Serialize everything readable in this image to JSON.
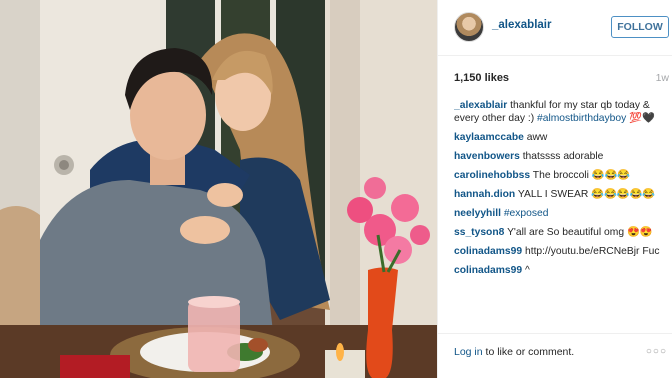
{
  "post": {
    "username": "_alexablair",
    "follow_label": "FOLLOW",
    "likes": "1,150 likes",
    "age": "1w"
  },
  "comments": [
    {
      "user": "_alexablair",
      "text": "thankful for my star qb today & every other day :) ",
      "tag": "#almostbirthdayboy",
      "extra": " 💯🖤"
    },
    {
      "user": "kaylaamccabe",
      "text": "aww"
    },
    {
      "user": "havenbowers",
      "text": "thatssss adorable"
    },
    {
      "user": "carolinehobbss",
      "text": "The broccoli 😂😂😂"
    },
    {
      "user": "hannah.dion",
      "text": "YALL I SWEAR 😂😂😂😂😂"
    },
    {
      "user": "neelyyhill",
      "tag": "#exposed"
    },
    {
      "user": "ss_tyson8",
      "text": "Y'all are So beautiful omg 😍😍"
    },
    {
      "user": "colinadams99",
      "text": "http://youtu.be/eRCNeBjr Fuc"
    },
    {
      "user": "colinadams99",
      "text": "^"
    }
  ],
  "footer": {
    "login_link": "Log in",
    "login_rest": " to like or comment.",
    "more": "○○○"
  },
  "icons": [
    "avatar",
    "more-options-icon"
  ]
}
